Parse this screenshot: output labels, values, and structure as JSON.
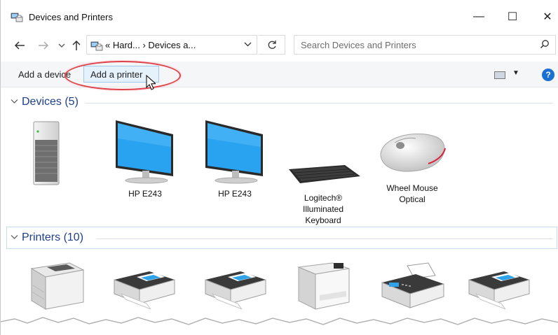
{
  "window": {
    "title": "Devices and Printers"
  },
  "controls": {
    "minimize": "—",
    "maximize": "☐",
    "close": "✕"
  },
  "nav": {
    "back_icon": "arrow-left-icon",
    "forward_icon": "arrow-right-icon",
    "recent_icon": "chevron-down-icon",
    "up_icon": "arrow-up-icon",
    "breadcrumb": "« Hard...  ›  Devices a...",
    "refresh_icon": "refresh-icon"
  },
  "search": {
    "placeholder": "Search Devices and Printers",
    "icon": "search-icon"
  },
  "toolbar": {
    "add_device": "Add a device",
    "add_printer": "Add a printer",
    "help": "?"
  },
  "groups": {
    "devices": {
      "title": "Devices (5)"
    },
    "printers": {
      "title": "Printers (10)"
    }
  },
  "devices": [
    {
      "label": "",
      "icon": "computer-tower-icon"
    },
    {
      "label": "HP E243",
      "icon": "monitor-icon"
    },
    {
      "label": "HP E243",
      "icon": "monitor-icon"
    },
    {
      "label": "Logitech®\nIlluminated\nKeyboard",
      "icon": "keyboard-icon"
    },
    {
      "label": "Wheel Mouse\nOptical",
      "icon": "mouse-icon"
    }
  ],
  "printers": [
    {
      "icon": "laser-printer-icon"
    },
    {
      "icon": "printer-icon"
    },
    {
      "icon": "printer-icon"
    },
    {
      "icon": "color-printer-icon"
    },
    {
      "icon": "fax-icon"
    },
    {
      "icon": "printer-icon"
    }
  ],
  "colors": {
    "accent": "#1e3f8c",
    "highlight_ring": "#e0424b",
    "selected_button": "#e5f1fb",
    "help": "#1a6fd2"
  }
}
